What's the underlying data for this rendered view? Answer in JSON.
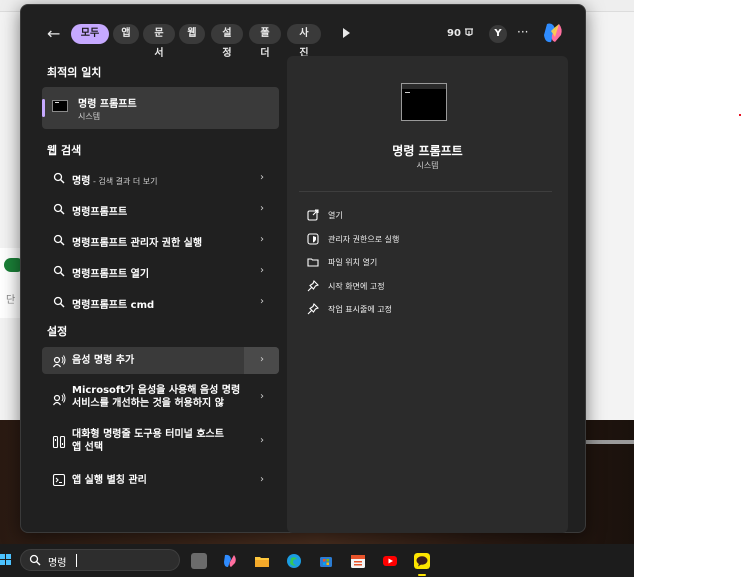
{
  "background": {
    "letter": "단"
  },
  "topbar": {
    "tabs": [
      {
        "label": "모두",
        "active": true
      },
      {
        "label": "앱"
      },
      {
        "label": "문서"
      },
      {
        "label": "웹"
      },
      {
        "label": "설정"
      },
      {
        "label": "폴더"
      },
      {
        "label": "사진"
      }
    ],
    "points": "90",
    "avatar": "Y",
    "more": "···"
  },
  "best_match": {
    "section_title": "최적의 일치",
    "name": "명령 프롬프트",
    "subtitle": "시스템"
  },
  "web_search": {
    "section_title": "웹 검색",
    "items": [
      {
        "bold": "명령",
        "suffix": " - 검색 결과 더 보기"
      },
      {
        "bold": "명령프롬프트",
        "suffix": ""
      },
      {
        "bold": "명령프롬프트 관리자 권한 실행",
        "suffix": ""
      },
      {
        "bold": "명령프롬프트 열기",
        "suffix": ""
      },
      {
        "bold": "명령프롬프트 cmd",
        "suffix": ""
      }
    ]
  },
  "settings": {
    "section_title": "설정",
    "items": [
      {
        "line1": "음성 명령 추가",
        "line2": ""
      },
      {
        "line1": "Microsoft가 음성을 사용해 음성 명령",
        "line2": "서비스를 개선하는 것을 허용하지 않"
      },
      {
        "line1": "대화형 명령줄 도구용 터미널 호스트",
        "line2": "앱 선택"
      },
      {
        "line1": "앱 실행 별칭 관리",
        "line2": ""
      }
    ]
  },
  "preview": {
    "name": "명령 프롬프트",
    "subtitle": "시스템",
    "actions": [
      {
        "label": "열기",
        "icon": "open-icon"
      },
      {
        "label": "관리자 권한으로 실행",
        "icon": "shield-icon"
      },
      {
        "label": "파일 위치 열기",
        "icon": "folder-icon"
      },
      {
        "label": "시작 화면에 고정",
        "icon": "pin-icon"
      },
      {
        "label": "작업 표시줄에 고정",
        "icon": "pin-icon"
      }
    ]
  },
  "taskbar": {
    "search_value": "명령"
  },
  "colors": {
    "accent": "#c6a9ff",
    "menu_bg": "#202020",
    "pane_bg": "#2b2b2b"
  }
}
